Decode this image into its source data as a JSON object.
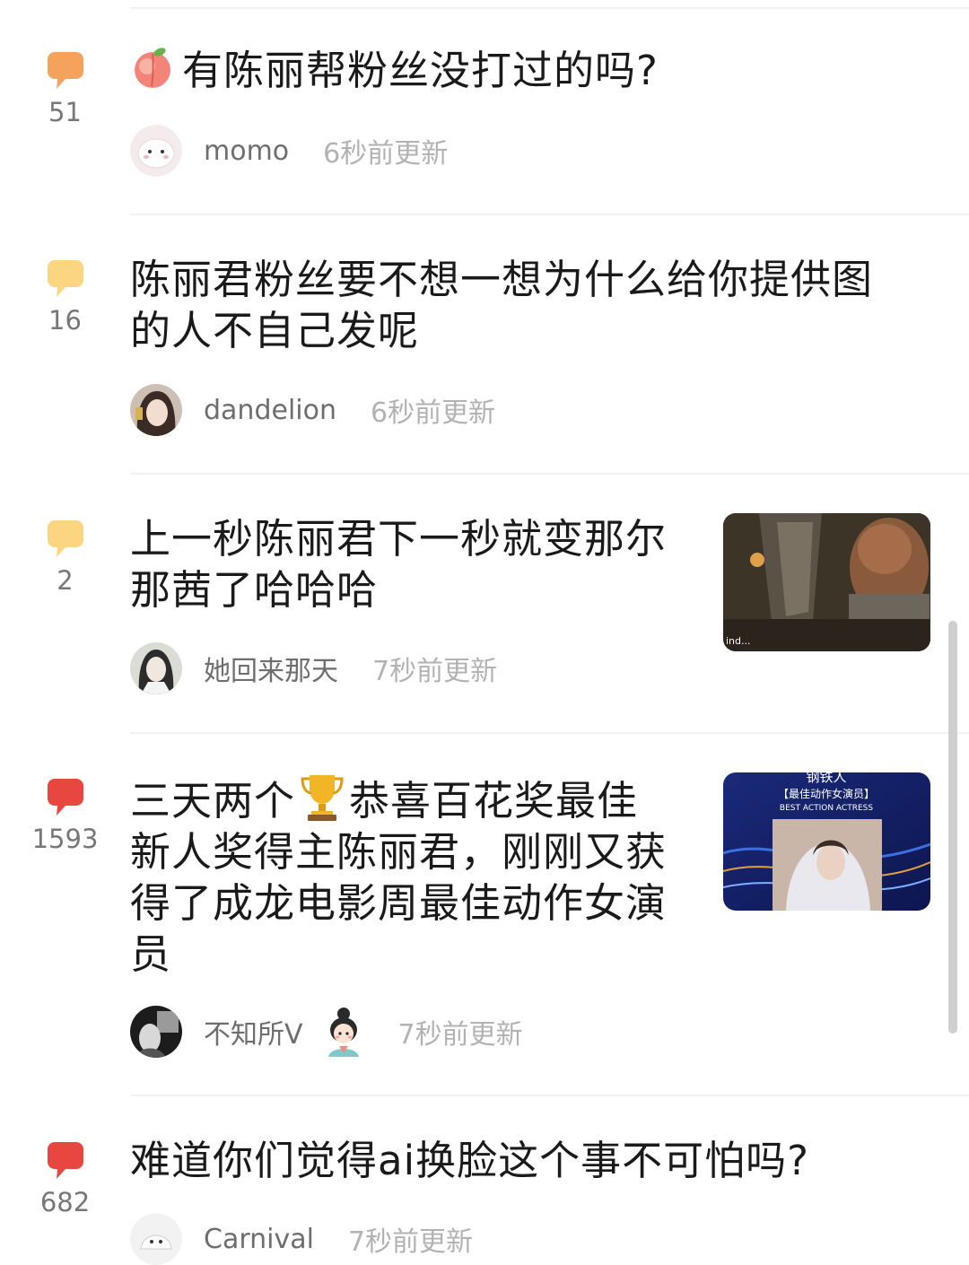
{
  "colors": {
    "bubble_high": "#e8473f",
    "bubble_mid": "#f5a35c",
    "bubble_low": "#fbd580",
    "text": "#1a1a1a",
    "author": "#6e6e6e",
    "time": "#b2b2b2"
  },
  "posts": [
    {
      "count": "51",
      "title_prefix_icon": "peach-emoji",
      "title": "有陈丽帮粉丝没打过的吗?",
      "author": "momo",
      "time": "6秒前更新"
    },
    {
      "count": "16",
      "title_line1": "陈丽君粉丝要不想一想为什么给你提供图",
      "title_line2": "的人不自己发呢",
      "author": "dandelion",
      "time": "6秒前更新"
    },
    {
      "count": "2",
      "title_line1": "上一秒陈丽君下一秒就变那尔",
      "title_line2": "那茜了哈哈哈",
      "author": "她回来那天",
      "time": "7秒前更新",
      "thumb_caption": "ind..."
    },
    {
      "count": "1593",
      "title_line1_a": "三天两个",
      "title_line1_icon": "trophy-emoji",
      "title_line1_b": "恭喜百花奖最佳",
      "title_line2": "新人奖得主陈丽君，刚刚又获",
      "title_line3": "得了成龙电影周最佳动作女演",
      "title_line4": "员",
      "author": "不知所V",
      "time": "7秒前更新",
      "thumb_line1": "钢铁人",
      "thumb_line2": "【最佳动作女演员】",
      "thumb_line3": "BEST ACTION ACTRESS"
    },
    {
      "count": "682",
      "title": "难道你们觉得ai换脸这个事不可怕吗?",
      "author": "Carnival",
      "time": "7秒前更新"
    }
  ]
}
